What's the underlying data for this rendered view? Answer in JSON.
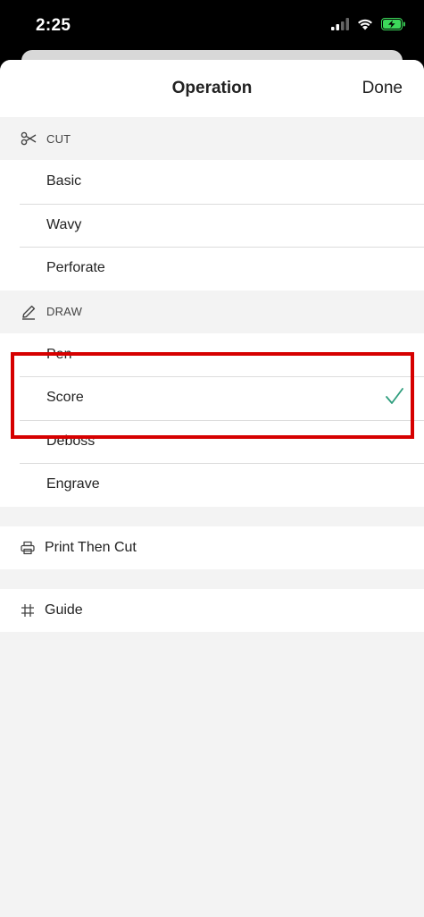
{
  "status_bar": {
    "time": "2:25"
  },
  "nav": {
    "title": "Operation",
    "done_label": "Done"
  },
  "sections": {
    "cut": {
      "header": "CUT",
      "icon": "scissors-icon",
      "items": [
        "Basic",
        "Wavy",
        "Perforate"
      ]
    },
    "draw": {
      "header": "DRAW",
      "icon": "pen-icon",
      "items": [
        "Pen",
        "Score",
        "Deboss",
        "Engrave"
      ],
      "selected": "Score"
    }
  },
  "print_then_cut": {
    "label": "Print Then Cut",
    "icon": "printer-icon"
  },
  "guide": {
    "label": "Guide",
    "icon": "grid-hash-icon"
  },
  "colors": {
    "check": "#2e9d7d",
    "highlight": "#d60000"
  }
}
